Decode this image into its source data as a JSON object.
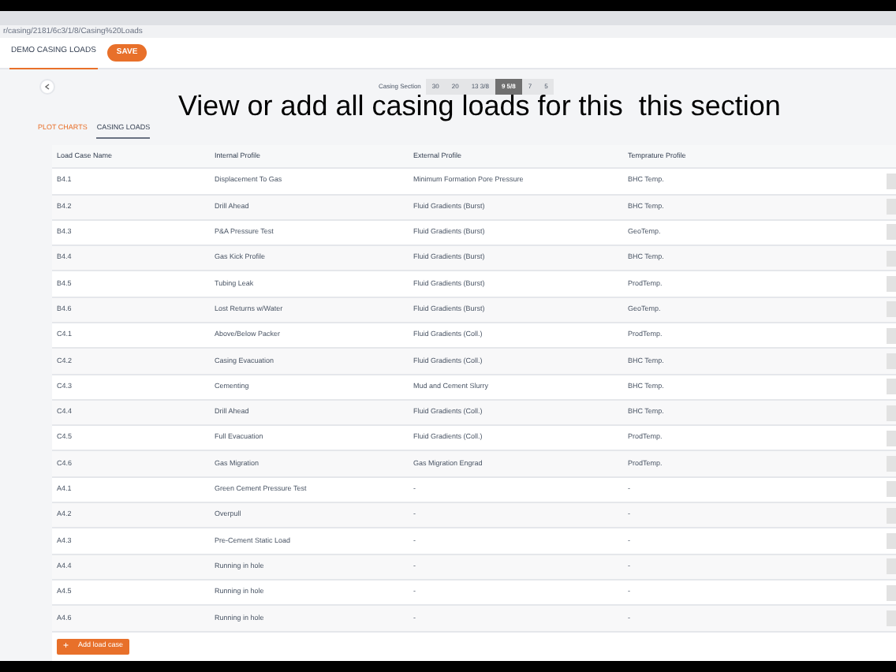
{
  "address_bar": {
    "url": "r/casing/2181/6c3/1/8/Casing%20Loads"
  },
  "header": {
    "tabs": [
      {
        "label": "DEMO CASING LOADS",
        "selected": true
      }
    ],
    "save_button": "SAVE"
  },
  "casing_section": {
    "label": "Casing Section",
    "options": [
      {
        "label": "30",
        "selected": false
      },
      {
        "label": "20",
        "selected": false
      },
      {
        "label": "13 3/8",
        "selected": false
      },
      {
        "label": "9 5/8",
        "selected": true
      },
      {
        "label": "7",
        "selected": false
      },
      {
        "label": "5",
        "selected": false
      }
    ]
  },
  "caption": "View or add all casing loads for this  this section",
  "view_tabs": [
    {
      "label": "PLOT CHARTS",
      "selected": false,
      "hovered": true
    },
    {
      "label": "CASING LOADS",
      "selected": true,
      "hovered": false
    }
  ],
  "table": {
    "columns": [
      "Load Case Name",
      "Internal Profile",
      "External Profile",
      "Temprature Profile"
    ],
    "rows": [
      [
        "B4.1",
        "Displacement To Gas",
        "Minimum Formation Pore Pressure",
        "BHC Temp."
      ],
      [
        "B4.2",
        "Drill Ahead",
        "Fluid Gradients (Burst)",
        "BHC Temp."
      ],
      [
        "B4.3",
        "P&A Pressure Test",
        "Fluid Gradients (Burst)",
        "GeoTemp."
      ],
      [
        "B4.4",
        "Gas Kick Profile",
        "Fluid Gradients (Burst)",
        "BHC Temp."
      ],
      [
        "B4.5",
        "Tubing Leak",
        "Fluid Gradients (Burst)",
        "ProdTemp."
      ],
      [
        "B4.6",
        "Lost Returns w/Water",
        "Fluid Gradients (Burst)",
        "GeoTemp."
      ],
      [
        "C4.1",
        "Above/Below Packer",
        "Fluid Gradients (Coll.)",
        "ProdTemp."
      ],
      [
        "C4.2",
        "Casing Evacuation",
        "Fluid Gradients (Coll.)",
        "BHC Temp."
      ],
      [
        "C4.3",
        "Cementing",
        "Mud and Cement Slurry",
        "BHC Temp."
      ],
      [
        "C4.4",
        "Drill Ahead",
        "Fluid Gradients (Coll.)",
        "BHC Temp."
      ],
      [
        "C4.5",
        "Full Evacuation",
        "Fluid Gradients (Coll.)",
        "ProdTemp."
      ],
      [
        "C4.6",
        "Gas Migration",
        "Gas Migration Engrad",
        "ProdTemp."
      ],
      [
        "A4.1",
        "Green Cement Pressure Test",
        "-",
        "-"
      ],
      [
        "A4.2",
        "Overpull",
        "-",
        "-"
      ],
      [
        "A4.3",
        "Pre-Cement Static Load",
        "-",
        "-"
      ],
      [
        "A4.4",
        "Running in hole",
        "-",
        "-"
      ],
      [
        "A4.5",
        "Running in hole",
        "-",
        "-"
      ],
      [
        "A4.6",
        "Running in hole",
        "-",
        "-"
      ]
    ]
  },
  "add_button": {
    "icon": "+",
    "label": "Add load case"
  }
}
